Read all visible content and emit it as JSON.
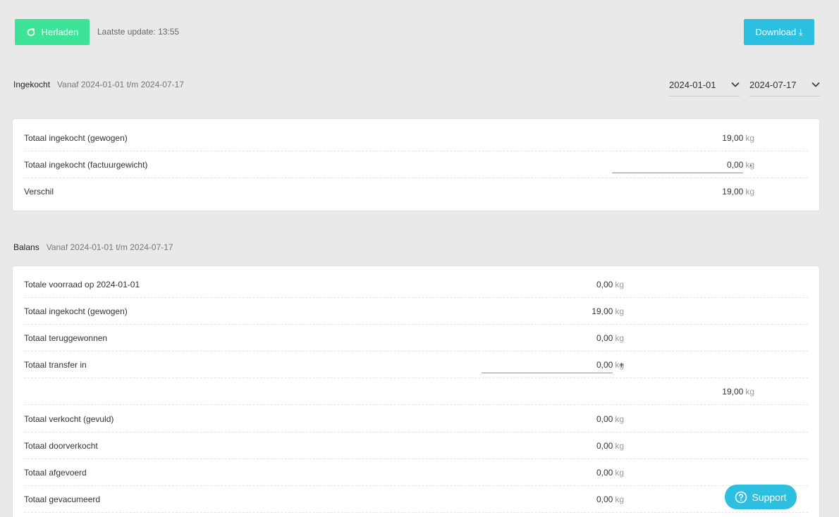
{
  "toolbar": {
    "reload_label": "Herladen",
    "last_update": "Laatste update: 13:55",
    "download_label": "Download ⤓"
  },
  "purchased": {
    "title": "Ingekocht",
    "range": "Vanaf 2024-01-01 t/m 2024-07-17",
    "from_date": "2024-01-01",
    "to_date": "2024-07-17",
    "rows": [
      {
        "label": "Totaal ingekocht (gewogen)",
        "value": "19,00",
        "unit": "kg",
        "op": ""
      },
      {
        "label": "Totaal ingekocht (factuurgewicht)",
        "value": "0,00",
        "unit": "kg",
        "op": "-"
      },
      {
        "label": "Verschil",
        "value": "19,00",
        "unit": "kg",
        "op": ""
      }
    ]
  },
  "balance": {
    "title": "Balans",
    "range": "Vanaf 2024-01-01 t/m 2024-07-17",
    "rows": [
      {
        "label": "Totale voorraad op 2024-01-01",
        "value": "0,00",
        "unit": "kg",
        "op": ""
      },
      {
        "label": "Totaal ingekocht (gewogen)",
        "value": "19,00",
        "unit": "kg",
        "op": ""
      },
      {
        "label": "Totaal teruggewonnen",
        "value": "0,00",
        "unit": "kg",
        "op": ""
      },
      {
        "label": "Totaal transfer in",
        "value": "0,00",
        "unit": "kg",
        "op": "+"
      },
      {
        "label": "",
        "value": "19,00",
        "unit": "kg",
        "op": ""
      },
      {
        "label": "Totaal verkocht (gevuld)",
        "value": "0,00",
        "unit": "kg",
        "op": ""
      },
      {
        "label": "Totaal doorverkocht",
        "value": "0,00",
        "unit": "kg",
        "op": ""
      },
      {
        "label": "Totaal afgevoerd",
        "value": "0,00",
        "unit": "kg",
        "op": ""
      },
      {
        "label": "Totaal gevacumeerd",
        "value": "0,00",
        "unit": "kg",
        "op": ""
      }
    ]
  },
  "support_label": "Support",
  "colors": {
    "reload": "#3ee39a",
    "accent": "#2dbfe0",
    "underline": "#5aa9d4"
  }
}
